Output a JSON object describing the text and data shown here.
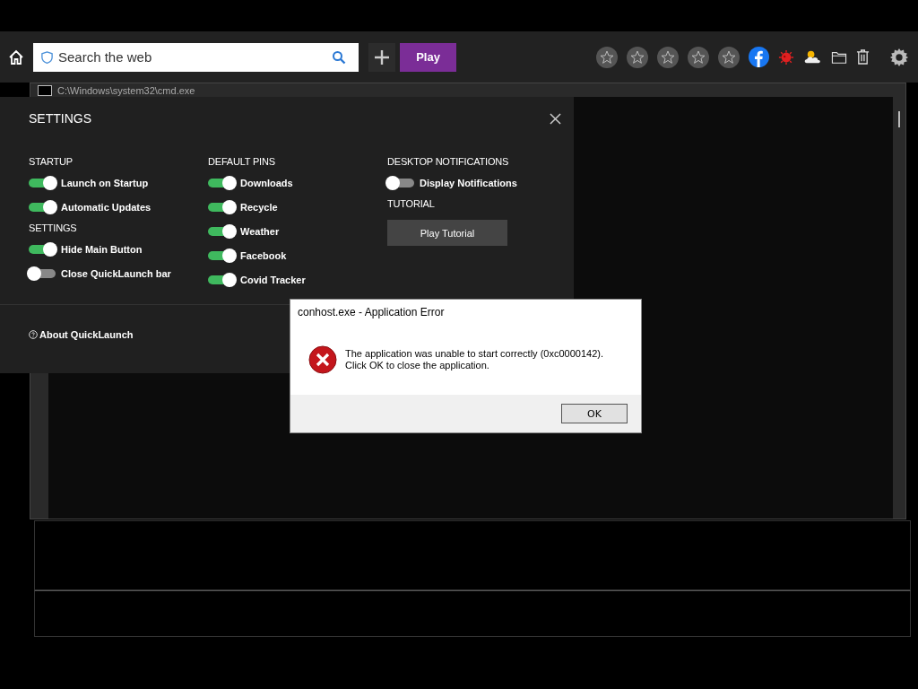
{
  "toolbar": {
    "search": {
      "placeholder": "Search the web"
    },
    "play_button": "Play"
  },
  "console_window": {
    "title": "C:\\Windows\\system32\\cmd.exe"
  },
  "settings": {
    "title": "SETTINGS",
    "columns": [
      {
        "groups": [
          {
            "heading": "STARTUP",
            "items": [
              {
                "label": "Launch on Startup",
                "on": true
              },
              {
                "label": "Automatic Updates",
                "on": true
              }
            ]
          },
          {
            "heading": "SETTINGS",
            "items": [
              {
                "label": "Hide Main Button",
                "on": true
              },
              {
                "label": "Close QuickLaunch bar",
                "on": false
              }
            ]
          }
        ]
      },
      {
        "groups": [
          {
            "heading": "DEFAULT PINS",
            "items": [
              {
                "label": "Downloads",
                "on": true
              },
              {
                "label": "Recycle",
                "on": true
              },
              {
                "label": "Weather",
                "on": true
              },
              {
                "label": "Facebook",
                "on": true
              },
              {
                "label": "Covid Tracker",
                "on": true
              }
            ]
          }
        ]
      },
      {
        "groups": [
          {
            "heading": "DESKTOP NOTIFICATIONS",
            "items": [
              {
                "label": "Display Notifications",
                "on": false
              }
            ]
          },
          {
            "heading": "TUTORIAL",
            "button": "Play Tutorial"
          }
        ]
      }
    ],
    "about_link": "About QuickLaunch"
  },
  "dialog": {
    "title": "conhost.exe - Application Error",
    "message_lines": [
      "The application was unable to start correctly (0xc0000142).",
      "Click OK to close the application."
    ],
    "button": "OK"
  }
}
